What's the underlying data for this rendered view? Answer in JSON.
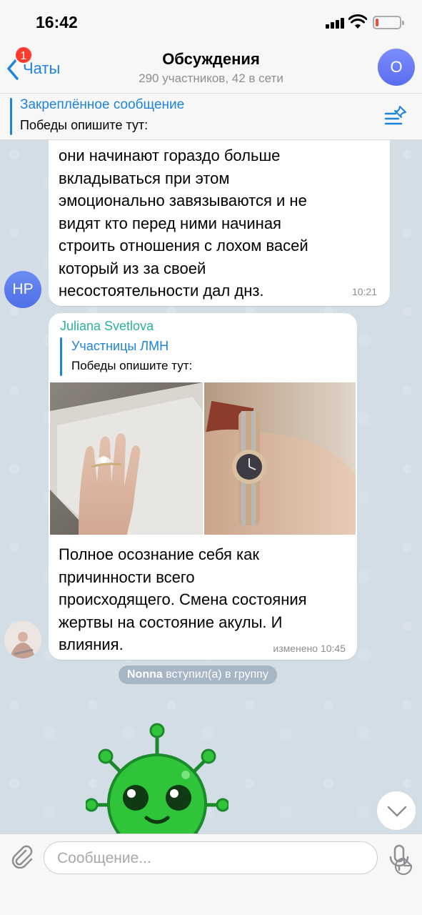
{
  "status_bar": {
    "time": "16:42"
  },
  "nav": {
    "back_label": "Чаты",
    "back_badge": "1",
    "title": "Обсуждения",
    "subtitle": "290 участников, 42 в сети",
    "avatar_letter": "О"
  },
  "pinned": {
    "title": "Закреплённое сообщение",
    "text": "Победы опишите тут:"
  },
  "messages": [
    {
      "avatar_initials": "НР",
      "text": "они начинают гораздо больше\nвкладываться при этом\nэмоционально завязываются и не\nвидят кто перед ними начиная\nстроить отношения с лохом васей\nкоторый из за своей\nнесостоятельности дал днз.",
      "time": "10:21"
    },
    {
      "sender": "Juliana Svetlova",
      "reply_name": "Участницы ЛМН",
      "reply_text": "Победы опишите тут:",
      "text": "Полное осознание себя как\nпричинности всего\nпроисходящего. Смена состояния\nжертвы на состояние акулы. И\nвлияния.",
      "time": "изменено 10:45"
    }
  ],
  "service": {
    "name": "Nonna",
    "action": "вступил(а) в группу"
  },
  "input": {
    "placeholder": "Сообщение..."
  },
  "colors": {
    "accent": "#1d84de",
    "sender_name": "#2bb0a0",
    "chat_bg": "#d2dde6"
  }
}
